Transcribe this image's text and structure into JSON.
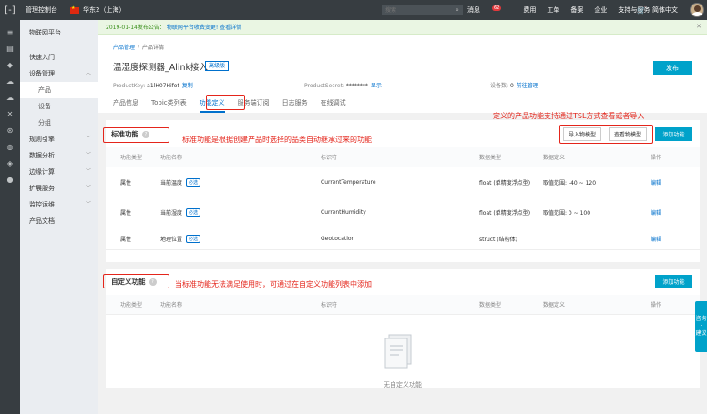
{
  "topbar": {
    "logo_glyph": "[-]",
    "console": "管理控制台",
    "region": "华东2（上海）",
    "search_placeholder": "搜索",
    "nav": [
      {
        "label": "消息",
        "badge": "62"
      },
      {
        "label": "费用"
      },
      {
        "label": "工单"
      },
      {
        "label": "备案"
      },
      {
        "label": "企业"
      },
      {
        "label": "支持与服务"
      }
    ],
    "cart_glyph": "🛒",
    "language": "简体中文"
  },
  "sidebar": {
    "title": "物联网平台",
    "items": [
      {
        "label": "快速入门",
        "type": "item"
      },
      {
        "label": "设备管理",
        "type": "group"
      },
      {
        "label": "产品",
        "type": "sub",
        "active": true
      },
      {
        "label": "设备",
        "type": "sub"
      },
      {
        "label": "分组",
        "type": "sub"
      },
      {
        "label": "规则引擎",
        "type": "group"
      },
      {
        "label": "数据分析",
        "type": "group"
      },
      {
        "label": "边缘计算",
        "type": "group"
      },
      {
        "label": "扩展服务",
        "type": "group"
      },
      {
        "label": "监控运维",
        "type": "group"
      },
      {
        "label": "产品文档",
        "type": "item"
      }
    ]
  },
  "notice": {
    "text": "2019-01-14发布公告：",
    "link": "物联网平台收费变更!",
    "detail": "查看详情"
  },
  "header": {
    "breadcrumb": [
      "产品管理",
      "产品详情"
    ],
    "title": "温湿度探测器_Alink接入",
    "tag": "高级版",
    "publish": "发布",
    "product_key_label": "ProductKey:",
    "product_key": "a1lH07Hifot",
    "copy": "复制",
    "product_secret_label": "ProductSecret:",
    "product_secret": "********",
    "show": "显示",
    "device_count_label": "设备数:",
    "device_count": "0",
    "goto_manage": "前往管理",
    "tabs": [
      "产品信息",
      "Topic类列表",
      "功能定义",
      "服务端订阅",
      "日志服务",
      "在线调试"
    ]
  },
  "standard": {
    "title": "标准功能",
    "annotation": "标准功能是根据创建产品时选择的品类自动继承过来的功能",
    "top_annotation": "定义的产品功能支持通过TSL方式查看或者导入",
    "import_btn": "导入物模型",
    "view_btn": "查看物模型",
    "add_btn": "添加功能",
    "columns": [
      "功能类型",
      "功能名称",
      "标识符",
      "数据类型",
      "数据定义",
      "操作"
    ],
    "required": "必选",
    "edit": "编辑",
    "rows": [
      {
        "type": "属性",
        "name": "当前温度",
        "id": "CurrentTemperature",
        "dtype": "float (单精度浮点型)",
        "def": "取值范围: -40 ~ 120"
      },
      {
        "type": "属性",
        "name": "当前湿度",
        "id": "CurrentHumidity",
        "dtype": "float (单精度浮点型)",
        "def": "取值范围: 0 ~ 100"
      },
      {
        "type": "属性",
        "name": "地理位置",
        "id": "GeoLocation",
        "dtype": "struct (结构体)",
        "def": ""
      }
    ]
  },
  "custom": {
    "title": "自定义功能",
    "annotation": "当标准功能无法满足使用时，可通过在自定义功能列表中添加",
    "add_btn": "添加功能",
    "columns": [
      "功能类型",
      "功能名称",
      "标识符",
      "数据类型",
      "数据定义",
      "操作"
    ],
    "empty": "无自定义功能"
  },
  "help": {
    "line1": "咨询",
    "line2": "·",
    "line3": "建议"
  },
  "colors": {
    "primary": "#00a2ca",
    "link": "#0070cc",
    "annotation": "#e4251b",
    "topbar": "#373d41"
  }
}
